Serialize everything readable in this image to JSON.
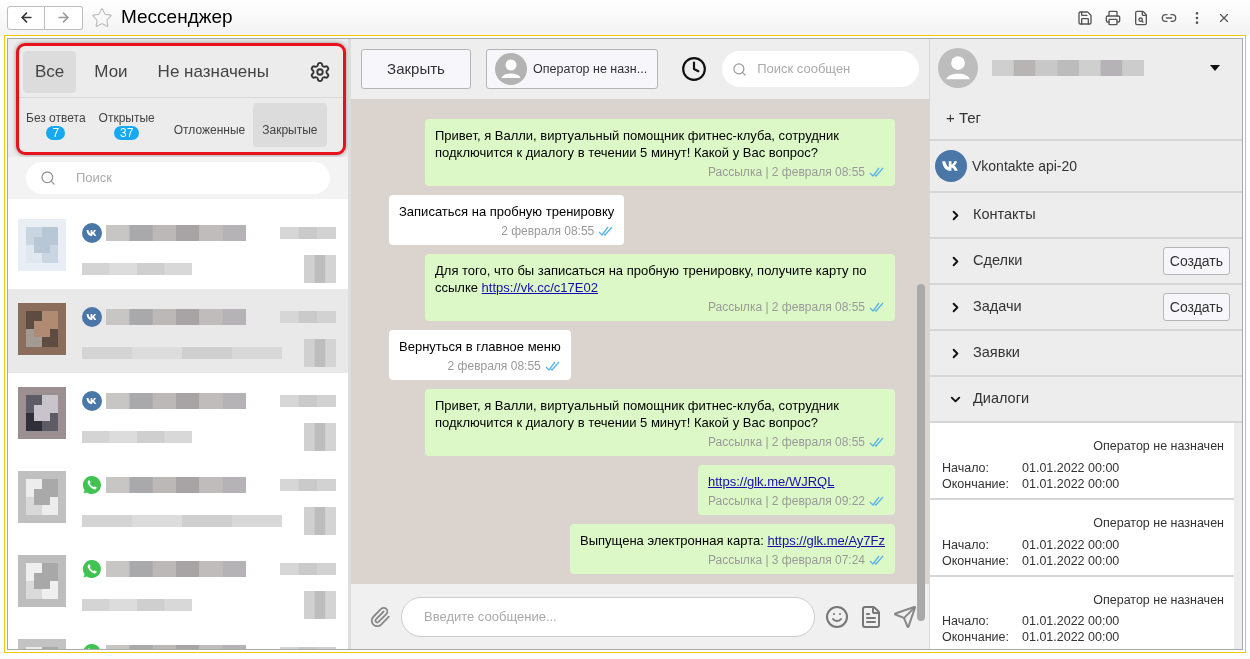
{
  "window": {
    "title": "Мессенджер"
  },
  "filter_tabs": [
    {
      "label": "Все",
      "selected": true
    },
    {
      "label": "Мои",
      "selected": false
    },
    {
      "label": "Не назначены",
      "selected": false
    }
  ],
  "status_tabs": [
    {
      "label": "Без ответа",
      "count": "7",
      "selected": false
    },
    {
      "label": "Открытые",
      "count": "37",
      "selected": false
    },
    {
      "label": "Отложенные",
      "selected": false
    },
    {
      "label": "Закрытые",
      "selected": true
    }
  ],
  "list_search": {
    "placeholder": "Поиск"
  },
  "conversations": [
    {
      "kind": "vk",
      "selected": false
    },
    {
      "kind": "vk",
      "selected": true
    },
    {
      "kind": "vk",
      "selected": false
    },
    {
      "kind": "whatsapp",
      "selected": false
    },
    {
      "kind": "whatsapp",
      "selected": false
    },
    {
      "kind": "whatsapp",
      "selected": false
    }
  ],
  "toolbar": {
    "close_button": "Закрыть",
    "operator": "Оператор не назн...",
    "search": {
      "placeholder": "Поиск сообщен"
    }
  },
  "messages": [
    {
      "kind": "outgoing",
      "parts": [
        {
          "kind": "text",
          "text": "Привет, я Валли, виртуальный помощник фитнес-клуба, сотрудник подключится к диалогу в течении 5 минут! Какой у Вас вопрос?"
        }
      ],
      "meta": "Рассылка | 2 февраля 08:55",
      "read": true
    },
    {
      "kind": "incoming",
      "parts": [
        {
          "kind": "text",
          "text": "Записаться на пробную тренировку"
        }
      ],
      "meta": "2 февраля 08:55",
      "read": true
    },
    {
      "kind": "outgoing",
      "parts": [
        {
          "kind": "text",
          "text": "Для того, что бы записаться на пробную тренировку, получите карту по ссылке "
        },
        {
          "kind": "link",
          "text": "https://vk.cc/c17E02"
        }
      ],
      "meta": "Рассылка | 2 февраля 08:55",
      "read": true
    },
    {
      "kind": "incoming",
      "parts": [
        {
          "kind": "text",
          "text": "Вернуться в главное меню"
        }
      ],
      "meta": "2 февраля 08:55",
      "read": true
    },
    {
      "kind": "outgoing",
      "parts": [
        {
          "kind": "text",
          "text": "Привет, я Валли, виртуальный помощник фитнес-клуба, сотрудник подключится к диалогу в течении 5 минут! Какой у Вас вопрос?"
        }
      ],
      "meta": "Рассылка | 2 февраля 08:55",
      "read": true
    },
    {
      "kind": "outgoing",
      "parts": [
        {
          "kind": "link",
          "text": "https://glk.me/WJRQL"
        }
      ],
      "meta": "Рассылка | 2 февраля 09:22",
      "read": true
    },
    {
      "kind": "outgoing",
      "parts": [
        {
          "kind": "text",
          "text": "Выпущена электронная карта: "
        },
        {
          "kind": "link",
          "text": "https://glk.me/Ay7Fz"
        }
      ],
      "meta": "Рассылка | 3 февраля 07:24",
      "read": true
    }
  ],
  "composer": {
    "placeholder": "Введите сообщение..."
  },
  "sidebar": {
    "tag_button": "+ Тег",
    "channel": "Vkontakte api-20",
    "sections": [
      {
        "title": "Контакты",
        "expanded": false
      },
      {
        "title": "Сделки",
        "expanded": false,
        "action": "Создать"
      },
      {
        "title": "Задачи",
        "expanded": false,
        "action": "Создать"
      },
      {
        "title": "Заявки",
        "expanded": false
      },
      {
        "title": "Диалоги",
        "expanded": true
      }
    ],
    "dialogs": [
      {
        "operator": "Оператор не назначен",
        "start_label": "Начало:",
        "start": "01.01.2022 00:00",
        "end_label": "Окончание:",
        "end": "01.01.2022 00:00"
      },
      {
        "operator": "Оператор не назначен",
        "start_label": "Начало:",
        "start": "01.01.2022 00:00",
        "end_label": "Окончание:",
        "end": "01.01.2022 00:00"
      },
      {
        "operator": "Оператор не назначен",
        "start_label": "Начало:",
        "start": "01.01.2022 00:00",
        "end_label": "Окончание:",
        "end": "01.01.2022 00:00"
      }
    ]
  }
}
